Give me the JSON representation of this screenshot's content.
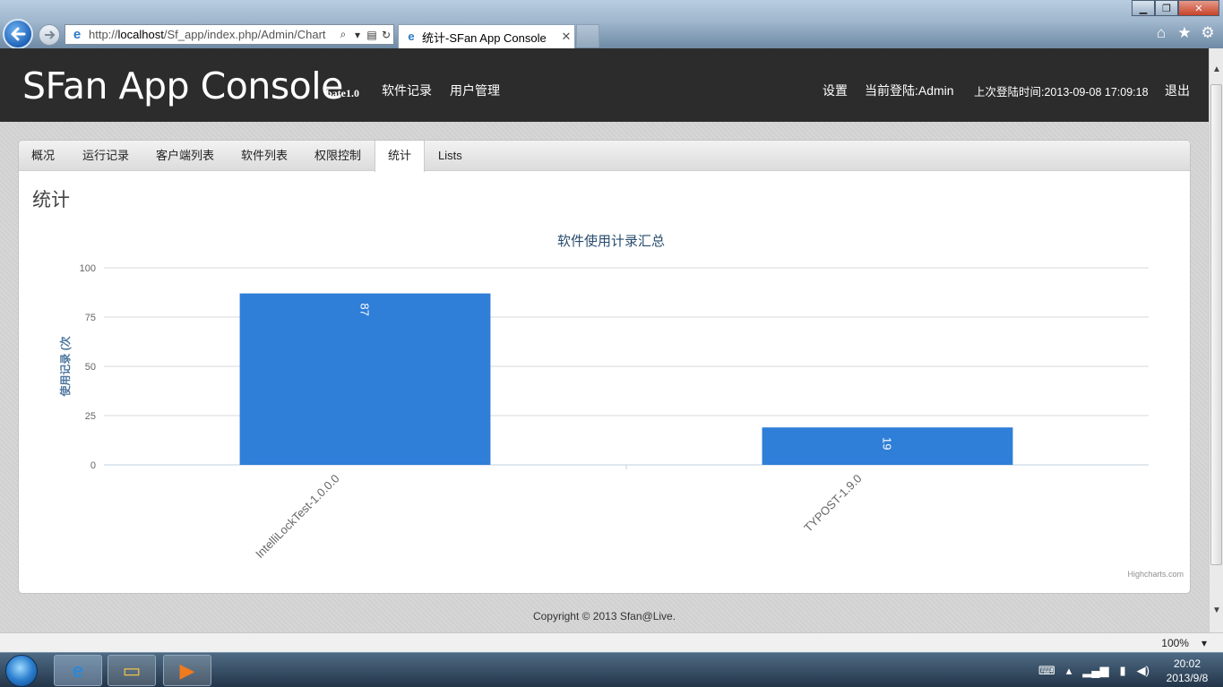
{
  "browser": {
    "url_prefix": "http://",
    "url_host": "localhost",
    "url_path": "/Sf_app/index.php/Admin/Chart",
    "tab_title": "统计-SFan App Console",
    "zoom": "100%"
  },
  "header": {
    "brand": "SFan App Console",
    "version": "bate1.0",
    "nav": [
      "软件记录",
      "用户管理"
    ],
    "settings": "设置",
    "current_user": "当前登陆:Admin",
    "last_login": "上次登陆时间:2013-09-08 17:09:18",
    "logout": "退出"
  },
  "tabs": [
    "概况",
    "运行记录",
    "客户端列表",
    "软件列表",
    "权限控制",
    "统计",
    "Lists"
  ],
  "active_tab": "统计",
  "section_heading": "统计",
  "chart_data": {
    "type": "bar",
    "title": "软件使用计录汇总",
    "ylabel": "使用记录 (次",
    "xlabel": "",
    "categories": [
      "IntelliLockTest-1.0.0.0",
      "TYPOST-1.9.0"
    ],
    "values": [
      87,
      19
    ],
    "ylim": [
      0,
      100
    ],
    "yticks": [
      0,
      25,
      50,
      75,
      100
    ],
    "grid": true,
    "legend": "none",
    "bar_color": "#2f7ed8",
    "credits": "Highcharts.com"
  },
  "footer": "Copyright © 2013 Sfan@Live.",
  "taskbar": {
    "time": "20:02",
    "date": "2013/9/8"
  }
}
